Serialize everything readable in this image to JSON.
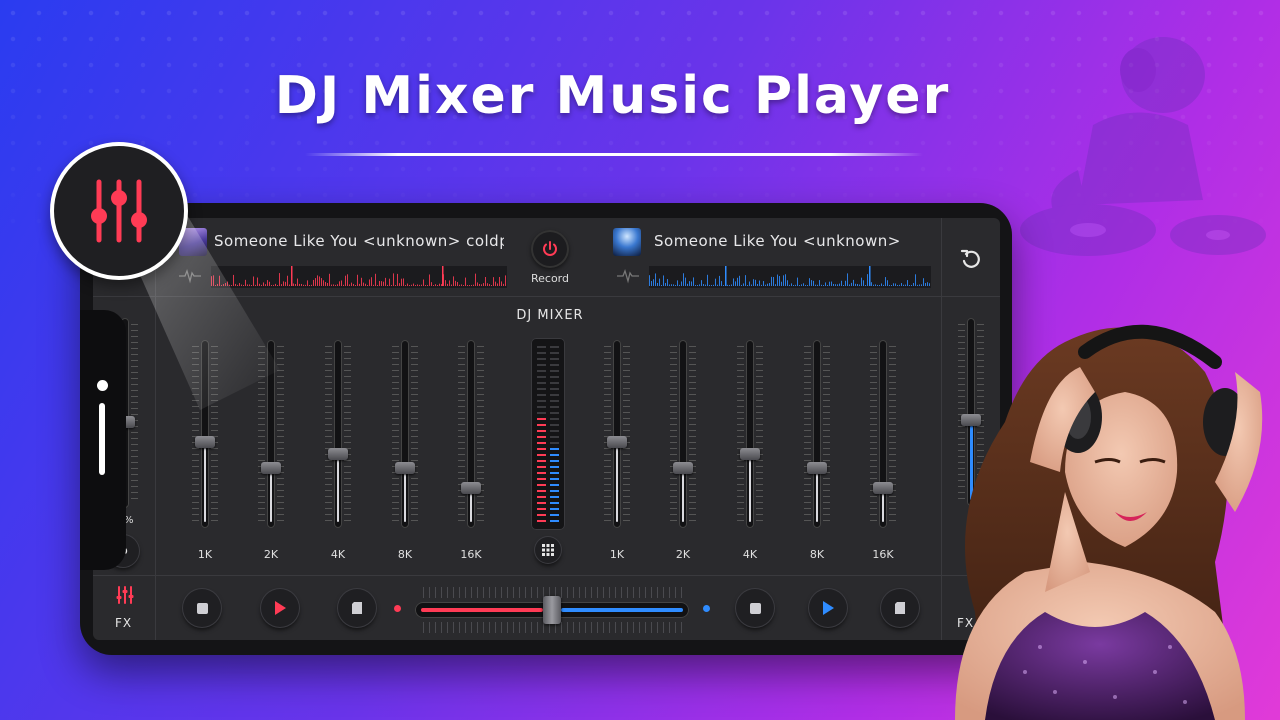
{
  "headline": "DJ Mixer Music Player",
  "deck_left": {
    "track_title": "Someone Like You <unknown> coldplay",
    "accent": "#ff3b55"
  },
  "deck_right": {
    "track_title": "Someone Like You <unknown> coldplay",
    "accent": "#2f8cff"
  },
  "record": {
    "label": "Record",
    "icon": "power-icon"
  },
  "mixer": {
    "title": "DJ MIXER",
    "left_bands": [
      {
        "label": "1K",
        "level": 0.45
      },
      {
        "label": "2K",
        "level": 0.3
      },
      {
        "label": "4K",
        "level": 0.38
      },
      {
        "label": "8K",
        "level": 0.3
      },
      {
        "label": "16K",
        "level": 0.18
      }
    ],
    "right_bands": [
      {
        "label": "1K",
        "level": 0.45
      },
      {
        "label": "2K",
        "level": 0.3
      },
      {
        "label": "4K",
        "level": 0.38
      },
      {
        "label": "8K",
        "level": 0.3
      },
      {
        "label": "16K",
        "level": 0.18
      }
    ],
    "vu_left_level": 0.6,
    "vu_right_level": 0.42,
    "grid_icon": "grid-icon"
  },
  "left_volume": {
    "percent_label": "%",
    "icon": "speaker-icon",
    "level": 0.45
  },
  "right_volume": {
    "level": 0.45
  },
  "crossfader": {
    "position": 0.5
  },
  "fx_left_label": "FX",
  "fx_right_label": "FX",
  "icons": {
    "reset": "rotate-ccw-icon",
    "stop": "stop-icon",
    "play": "play-icon",
    "sampler": "sd-card-icon",
    "equalizer": "equalizer-icon"
  },
  "colors": {
    "red": "#ff3b55",
    "blue": "#2f8cff",
    "screen_bg": "#2a2a2d"
  }
}
